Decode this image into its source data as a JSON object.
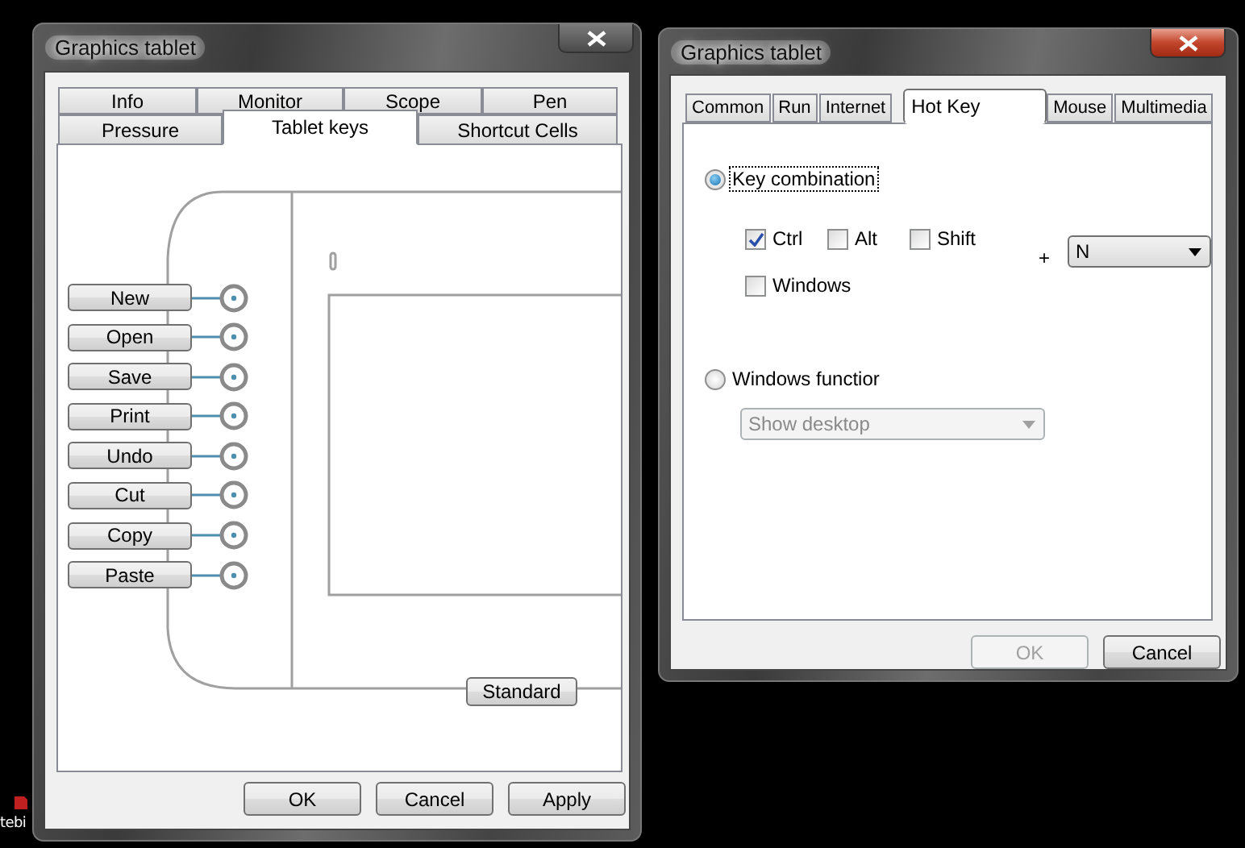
{
  "desktop": {
    "icon_label": "tebi"
  },
  "windows": [
    {
      "title": "Graphics tablet",
      "active": false,
      "tab_rows": [
        [
          {
            "label": "Info",
            "selected": false
          },
          {
            "label": "Monitor",
            "selected": false
          },
          {
            "label": "Scope",
            "selected": false
          },
          {
            "label": "Pen",
            "selected": false
          }
        ],
        [
          {
            "label": "Pressure",
            "selected": false
          },
          {
            "label": "Tablet keys",
            "selected": true
          },
          {
            "label": "Shortcut Cells",
            "selected": false
          }
        ]
      ],
      "tablet_keys": [
        {
          "label": "New"
        },
        {
          "label": "Open"
        },
        {
          "label": "Save"
        },
        {
          "label": "Print"
        },
        {
          "label": "Undo"
        },
        {
          "label": "Cut"
        },
        {
          "label": "Copy"
        },
        {
          "label": "Paste"
        }
      ],
      "standard_button": "Standard",
      "buttons": [
        {
          "label": "OK",
          "disabled": false
        },
        {
          "label": "Cancel",
          "disabled": false
        },
        {
          "label": "Apply",
          "disabled": false
        }
      ]
    },
    {
      "title": "Graphics tablet",
      "active": true,
      "tabs": [
        {
          "label": "Common",
          "selected": false
        },
        {
          "label": "Run",
          "selected": false
        },
        {
          "label": "Internet",
          "selected": false
        },
        {
          "label": "Hot Key",
          "selected": true
        },
        {
          "label": "Mouse",
          "selected": false
        },
        {
          "label": "Multimedia",
          "selected": false
        }
      ],
      "key_combination": {
        "label": "Key combination",
        "selected": true
      },
      "modifiers": [
        {
          "label": "Ctrl",
          "checked": true
        },
        {
          "label": "Alt",
          "checked": false
        },
        {
          "label": "Shift",
          "checked": false
        },
        {
          "label": "Windows",
          "checked": false
        }
      ],
      "plus": "+",
      "key_select": {
        "value": "N",
        "disabled": false
      },
      "windows_function": {
        "label": "Windows functior",
        "selected": false
      },
      "function_select": {
        "value": "Show desktop",
        "disabled": true
      },
      "buttons": [
        {
          "label": "OK",
          "disabled": true
        },
        {
          "label": "Cancel",
          "disabled": false
        }
      ]
    }
  ]
}
